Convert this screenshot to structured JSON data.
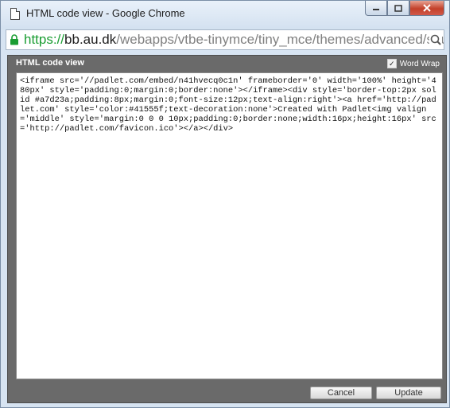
{
  "window": {
    "title": "HTML code view - Google Chrome",
    "controls": {
      "minimize_icon": "minimize-icon",
      "maximize_icon": "maximize-icon",
      "close_icon": "close-icon"
    }
  },
  "address": {
    "scheme": "https://",
    "host": "bb.au.dk",
    "path": "/webapps/vtbe-tinymce/tiny_mce/themes/advanced/sou",
    "lock_color": "#1a9d32"
  },
  "dialog": {
    "title": "HTML code view",
    "word_wrap_label": "Word Wrap",
    "word_wrap_checked": true,
    "code": "<iframe src='//padlet.com/embed/n41hvecq0c1n' frameborder='0' width='100%' height='480px' style='padding:0;margin:0;border:none'></iframe><div style='border-top:2px solid #a7d23a;padding:8px;margin:0;font-size:12px;text-align:right'><a href='http://padlet.com' style='color:#41555f;text-decoration:none'>Created with Padlet<img valign='middle' style='margin:0 0 0 10px;padding:0;border:none;width:16px;height:16px' src='http://padlet.com/favicon.ico'></a></div>",
    "cancel_label": "Cancel",
    "update_label": "Update"
  }
}
